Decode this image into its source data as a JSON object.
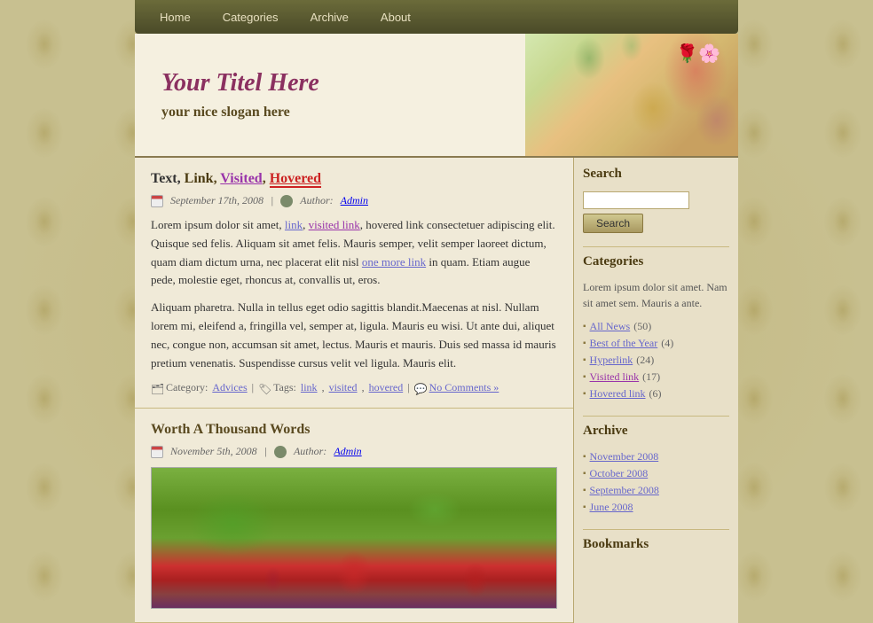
{
  "nav": {
    "items": [
      "Home",
      "Categories",
      "Archive",
      "About"
    ]
  },
  "header": {
    "title": "Your Titel Here",
    "slogan": "your nice slogan here"
  },
  "posts": [
    {
      "id": 1,
      "title_parts": {
        "text": "Text, Link, ",
        "visited": "Visited",
        "separator": ", ",
        "hovered": "Hovered"
      },
      "date": "September 17th, 2008",
      "author_label": "Author:",
      "author": "Admin",
      "body_before": "Lorem ipsum dolor sit amet, ",
      "link_text": "link",
      "body_after_link": ", ",
      "visited_link_text": "visited link",
      "body_continue": ", hovered link consectetuer adipiscing elit. Quisque sed felis. Aliquam sit amet felis. Mauris semper, velit semper laoreet dictum, quam diam dictum urna, nec placerat elit nisl ",
      "more_link_text": "one more link",
      "body_end": " in quam. Etiam augue pede, molestie eget, rhoncus at, convallis ut, eros.",
      "paragraph2": "Aliquam pharetra. Nulla in tellus eget odio sagittis blandit.Maecenas at nisl. Nullam lorem mi, eleifend a, fringilla vel, semper at, ligula. Mauris eu wisi. Ut ante dui, aliquet nec, congue non, accumsan sit amet, lectus. Mauris et mauris. Duis sed massa id mauris pretium venenatis. Suspendisse cursus velit vel ligula. Mauris elit.",
      "category_label": "Category:",
      "category": "Advices",
      "tags_label": "Tags:",
      "tags": [
        "link",
        "visited",
        "hovered"
      ],
      "comments": "No Comments »"
    },
    {
      "id": 2,
      "title": "Worth A Thousand Words",
      "date": "November 5th, 2008",
      "author_label": "Author:",
      "author": "Admin"
    }
  ],
  "sidebar": {
    "search": {
      "title": "Search",
      "placeholder": "",
      "button_label": "Search"
    },
    "categories": {
      "title": "Categories",
      "description": "Lorem ipsum dolor sit amet. Nam sit amet sem. Mauris a ante.",
      "items": [
        {
          "label": "All News",
          "count": "(50)",
          "visited": false
        },
        {
          "label": "Best of the Year",
          "count": "(4)",
          "visited": false
        },
        {
          "label": "Hyperlink",
          "count": "(24)",
          "visited": false
        },
        {
          "label": "Visited link",
          "count": "(17)",
          "visited": true
        },
        {
          "label": "Hovered link",
          "count": "(6)",
          "visited": false
        }
      ]
    },
    "archive": {
      "title": "Archive",
      "items": [
        {
          "label": "November 2008",
          "visited": false
        },
        {
          "label": "October 2008",
          "visited": false
        },
        {
          "label": "September 2008",
          "visited": false
        },
        {
          "label": "June 2008",
          "visited": false
        }
      ]
    },
    "bookmarks": {
      "title": "Bookmarks"
    }
  }
}
